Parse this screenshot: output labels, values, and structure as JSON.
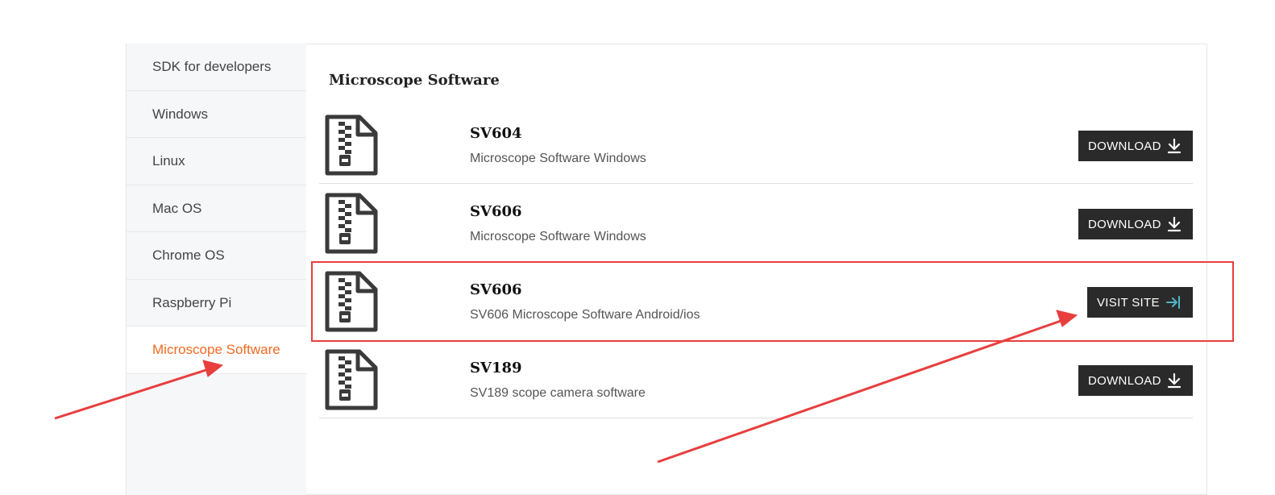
{
  "sidebar": {
    "items": [
      {
        "label": "SDK for developers"
      },
      {
        "label": "Windows"
      },
      {
        "label": "Linux"
      },
      {
        "label": "Mac OS"
      },
      {
        "label": "Chrome OS"
      },
      {
        "label": "Raspberry Pi"
      },
      {
        "label": "Microscope Software",
        "active": true
      }
    ]
  },
  "main": {
    "heading": "Microscope Software",
    "rows": [
      {
        "name": "SV604",
        "desc": "Microscope Software Windows",
        "action": "DOWNLOAD",
        "icon": "download-icon"
      },
      {
        "name": "SV606",
        "desc": "Microscope Software Windows",
        "action": "DOWNLOAD",
        "icon": "download-icon"
      },
      {
        "name": "SV606",
        "desc": "SV606 Microscope Software Android/ios",
        "action": "VISIT SITE",
        "icon": "external-link-icon"
      },
      {
        "name": "SV189",
        "desc": "SV189 scope camera software",
        "action": "DOWNLOAD",
        "icon": "download-icon"
      }
    ]
  },
  "colors": {
    "accent": "#f26a21",
    "button_bg": "#2a2a2a",
    "annotation": "#e83e3e",
    "visit_icon": "#4fb6c9"
  }
}
